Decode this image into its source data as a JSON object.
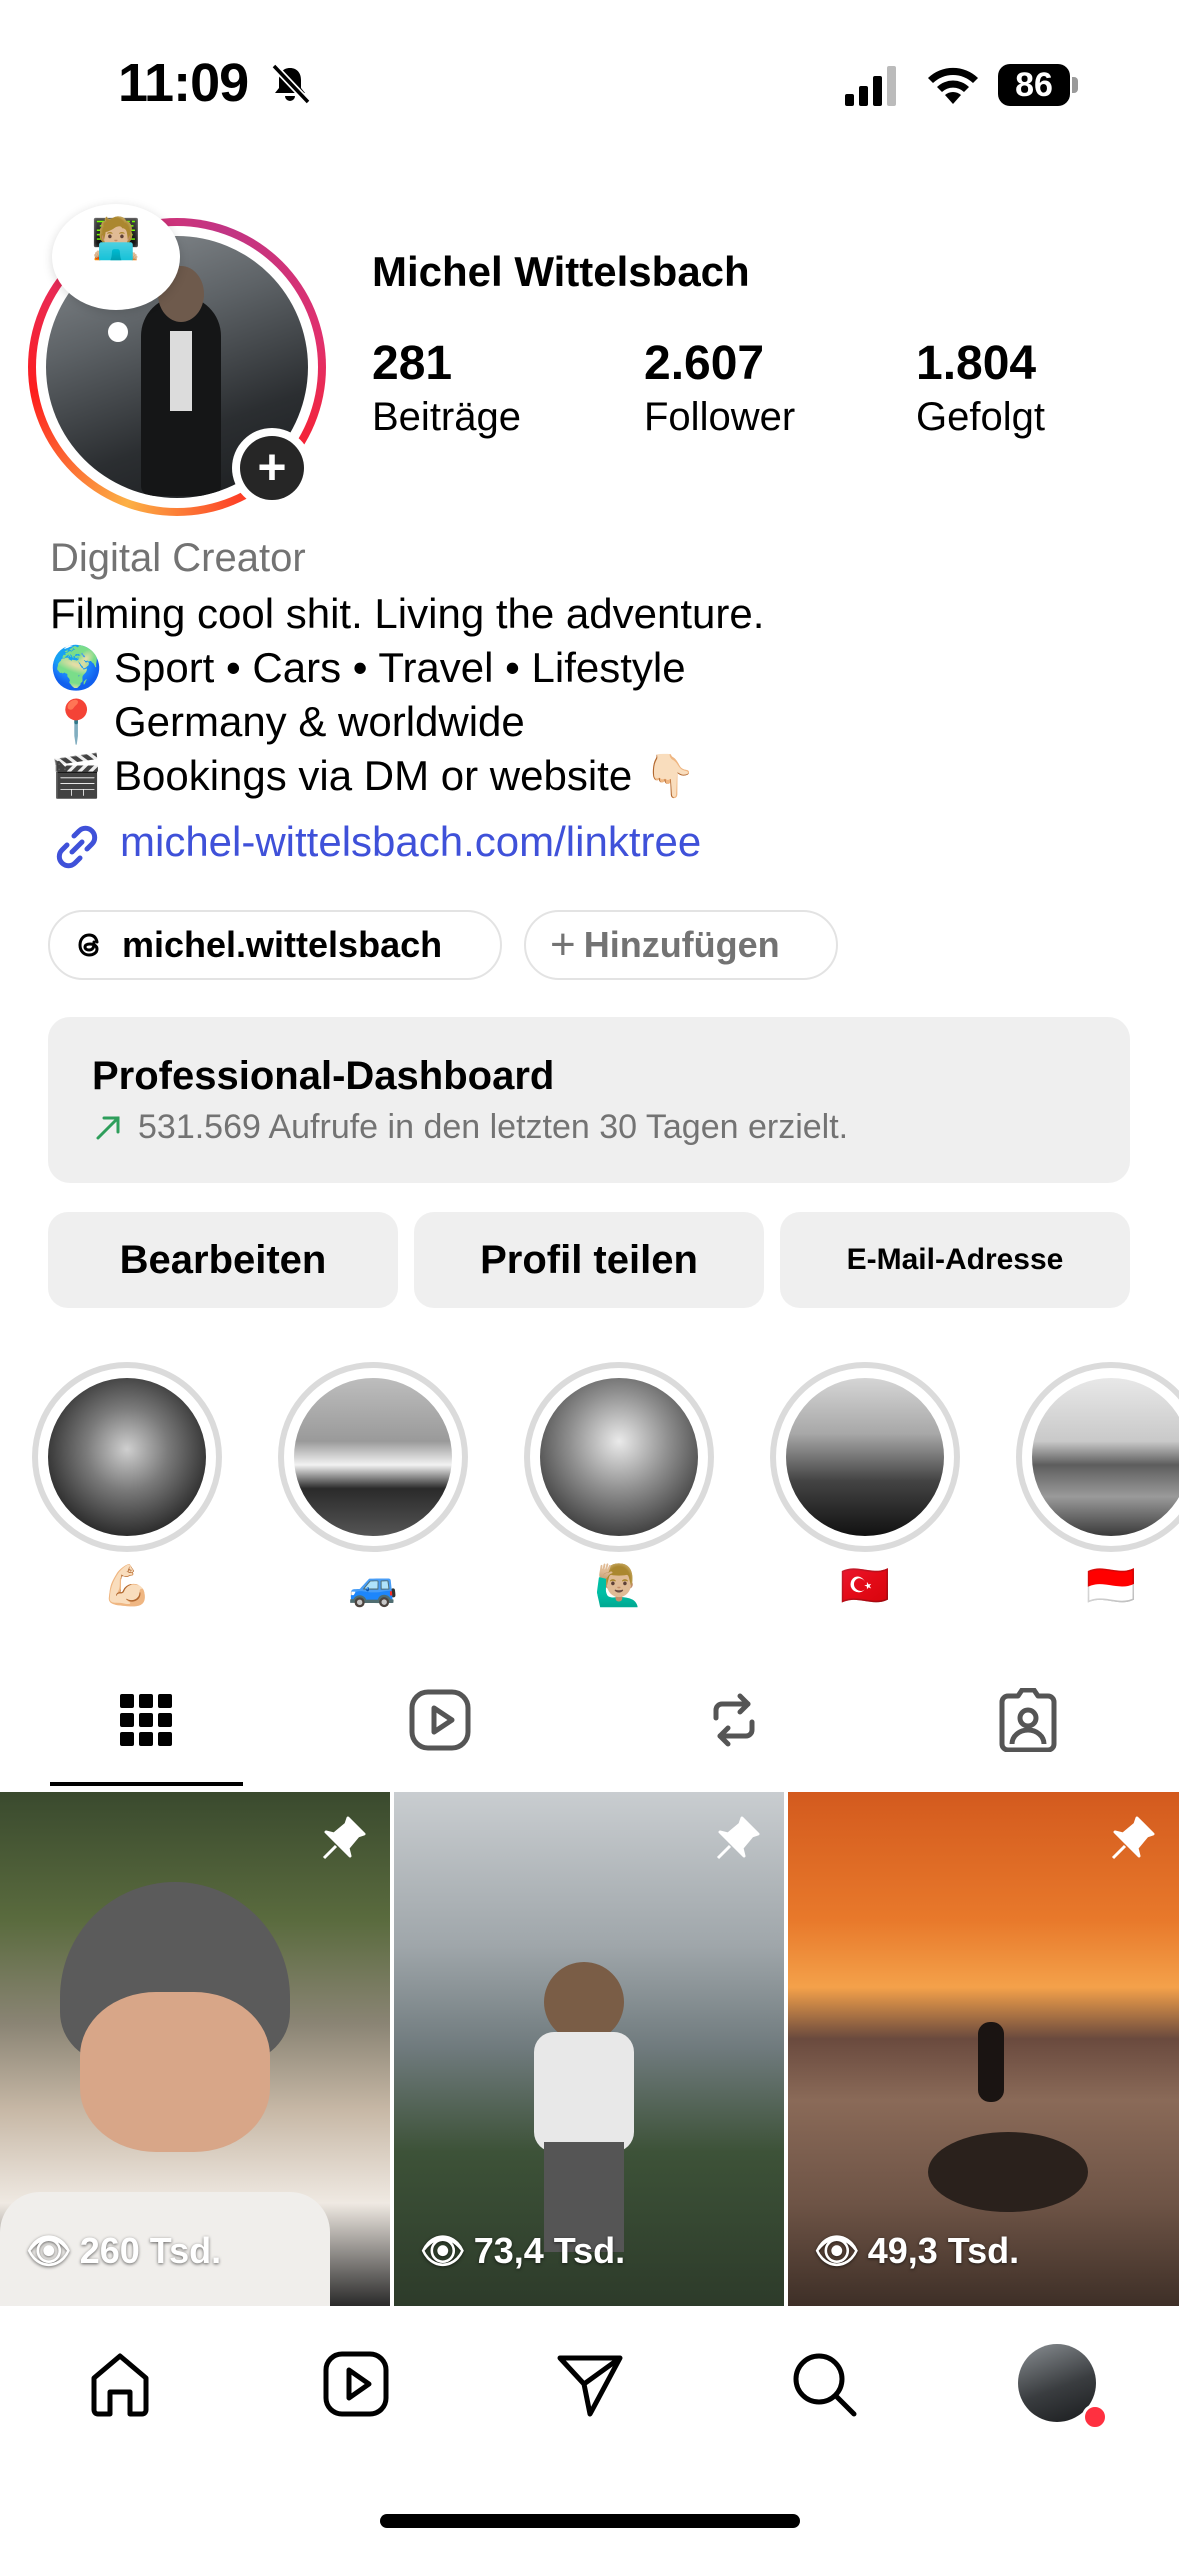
{
  "status_bar": {
    "time": "11:09",
    "battery": "86"
  },
  "profile": {
    "avatar_emoji": "🧑🏼‍💻",
    "username": "Michel Wittelsbach",
    "stats": [
      {
        "value": "281",
        "label": "Beiträge"
      },
      {
        "value": "2.607",
        "label": "Follower"
      },
      {
        "value": "1.804",
        "label": "Gefolgt"
      }
    ],
    "category": "Digital Creator",
    "bio": [
      "Filming cool shit. Living the adventure.",
      "🌍 Sport • Cars • Travel • Lifestyle",
      "📍 Germany & worldwide",
      "🎬 Bookings via DM or website 👇🏻"
    ],
    "link": "michel-wittelsbach.com/linktree"
  },
  "chips": {
    "threads": "michel.wittelsbach",
    "add": "Hinzufügen"
  },
  "dashboard": {
    "title": "Professional-Dashboard",
    "subtitle": "531.569 Aufrufe in den letzten 30 Tagen erzielt."
  },
  "buttons": {
    "edit": "Bearbeiten",
    "share": "Profil teilen",
    "email": "E-Mail-Adresse"
  },
  "highlights": [
    "💪🏻",
    "🚙",
    "🙋🏼‍♂️",
    "🇹🇷",
    "🇮🇩"
  ],
  "grid": [
    {
      "views": "260 Tsd.",
      "pinned": true
    },
    {
      "views": "73,4 Tsd.",
      "pinned": true
    },
    {
      "views": "49,3 Tsd.",
      "pinned": true
    }
  ],
  "tabs": [
    "grid-icon",
    "reels-icon",
    "reposts-icon",
    "tagged-icon"
  ],
  "nav": [
    "home-icon",
    "reels-icon",
    "direct-icon",
    "search-icon",
    "profile-avatar"
  ],
  "colors": {
    "link": "#3f51d9",
    "secondary_text": "#737373",
    "button_bg": "#efefef",
    "notification_dot": "#ff3040"
  }
}
